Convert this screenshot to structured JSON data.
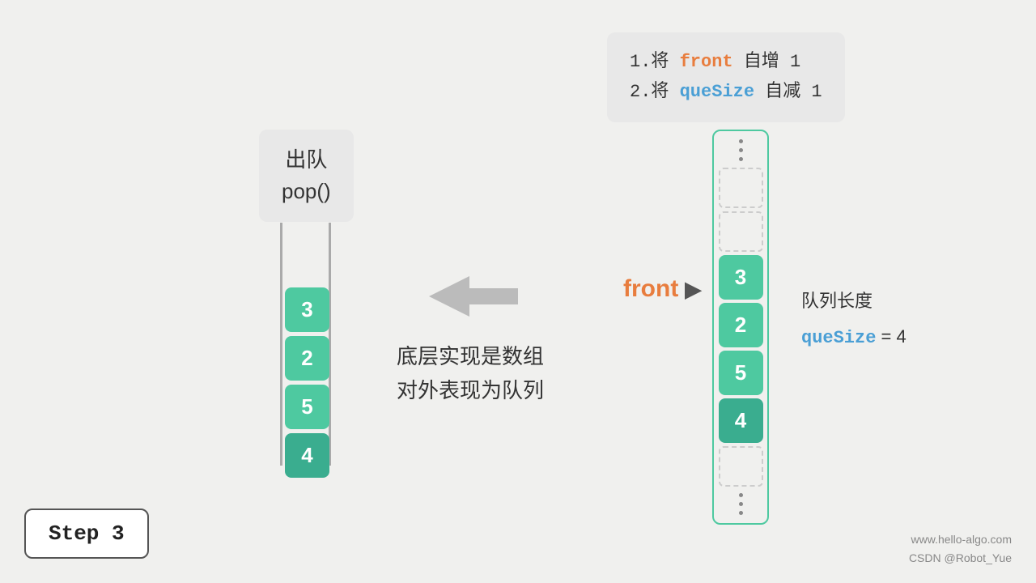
{
  "code_box": {
    "line1_prefix": "1.将 ",
    "line1_keyword": "front",
    "line1_suffix": " 自增 1",
    "line2_prefix": "2.将 ",
    "line2_keyword": "queSize",
    "line2_suffix": " 自减 1"
  },
  "pop_box": {
    "line1": "出队",
    "line2": "pop()"
  },
  "center_text": {
    "line1": "底层实现是数组",
    "line2": "对外表现为队列"
  },
  "front_label": {
    "text": "front",
    "arrow": "▶"
  },
  "queue_info": {
    "label": "队列长度",
    "quesize_label": "queSize",
    "equals": " = ",
    "value": "4"
  },
  "left_cells": [
    {
      "value": "3",
      "type": "green"
    },
    {
      "value": "2",
      "type": "green"
    },
    {
      "value": "5",
      "type": "green"
    },
    {
      "value": "4",
      "type": "teal"
    }
  ],
  "right_cells_top_empty": 2,
  "right_cells_values": [
    {
      "value": "3",
      "type": "green",
      "is_front": true
    },
    {
      "value": "2",
      "type": "green"
    },
    {
      "value": "5",
      "type": "green"
    },
    {
      "value": "4",
      "type": "teal"
    }
  ],
  "right_cells_bottom_empty": 1,
  "step": {
    "label": "Step  3"
  },
  "watermark": {
    "line1": "www.hello-algo.com",
    "line2": "CSDN @Robot_Yue"
  }
}
